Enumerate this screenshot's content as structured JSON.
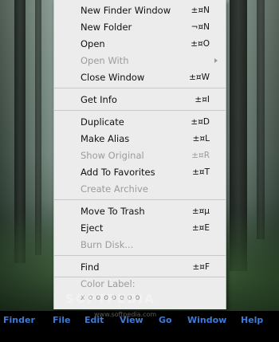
{
  "menu": {
    "items": [
      {
        "label": "New Finder Window",
        "shortcut": "±¤N",
        "disabled": false,
        "submenu": false
      },
      {
        "label": "New Folder",
        "shortcut": "¬¤N",
        "disabled": false,
        "submenu": false
      },
      {
        "label": "Open",
        "shortcut": "±¤O",
        "disabled": false,
        "submenu": false
      },
      {
        "label": "Open With",
        "shortcut": "",
        "disabled": true,
        "submenu": true
      },
      {
        "label": "Close Window",
        "shortcut": "±¤W",
        "disabled": false,
        "submenu": false
      },
      {
        "label": "Get Info",
        "shortcut": "±¤I",
        "disabled": false,
        "submenu": false
      },
      {
        "label": "Duplicate",
        "shortcut": "±¤D",
        "disabled": false,
        "submenu": false
      },
      {
        "label": "Make Alias",
        "shortcut": "±¤L",
        "disabled": false,
        "submenu": false
      },
      {
        "label": "Show Original",
        "shortcut": "±¤R",
        "disabled": true,
        "submenu": false
      },
      {
        "label": "Add To Favorites",
        "shortcut": "±¤T",
        "disabled": false,
        "submenu": false
      },
      {
        "label": "Create Archive",
        "shortcut": "",
        "disabled": true,
        "submenu": false
      },
      {
        "label": "Move To Trash",
        "shortcut": "±¤µ",
        "disabled": false,
        "submenu": false
      },
      {
        "label": "Eject",
        "shortcut": "±¤E",
        "disabled": false,
        "submenu": false
      },
      {
        "label": "Burn Disk...",
        "shortcut": "",
        "disabled": true,
        "submenu": false
      },
      {
        "label": "Find",
        "shortcut": "±¤F",
        "disabled": false,
        "submenu": false
      },
      {
        "label": "Color Label:",
        "shortcut": "",
        "disabled": true,
        "submenu": false
      }
    ],
    "color_label_dots": "x o o o o o o o"
  },
  "menubar": {
    "items": [
      "Finder",
      "File",
      "Edit",
      "View",
      "Go",
      "Window",
      "Help"
    ]
  },
  "watermark": {
    "main": "SOFTPEDIA",
    "small": "www.softpedia.com"
  },
  "colors": {
    "menu_background": "#ececec",
    "menubar_background": "#000000",
    "menubar_text": "#3d7ad9",
    "disabled_text": "#9b9b9b"
  }
}
